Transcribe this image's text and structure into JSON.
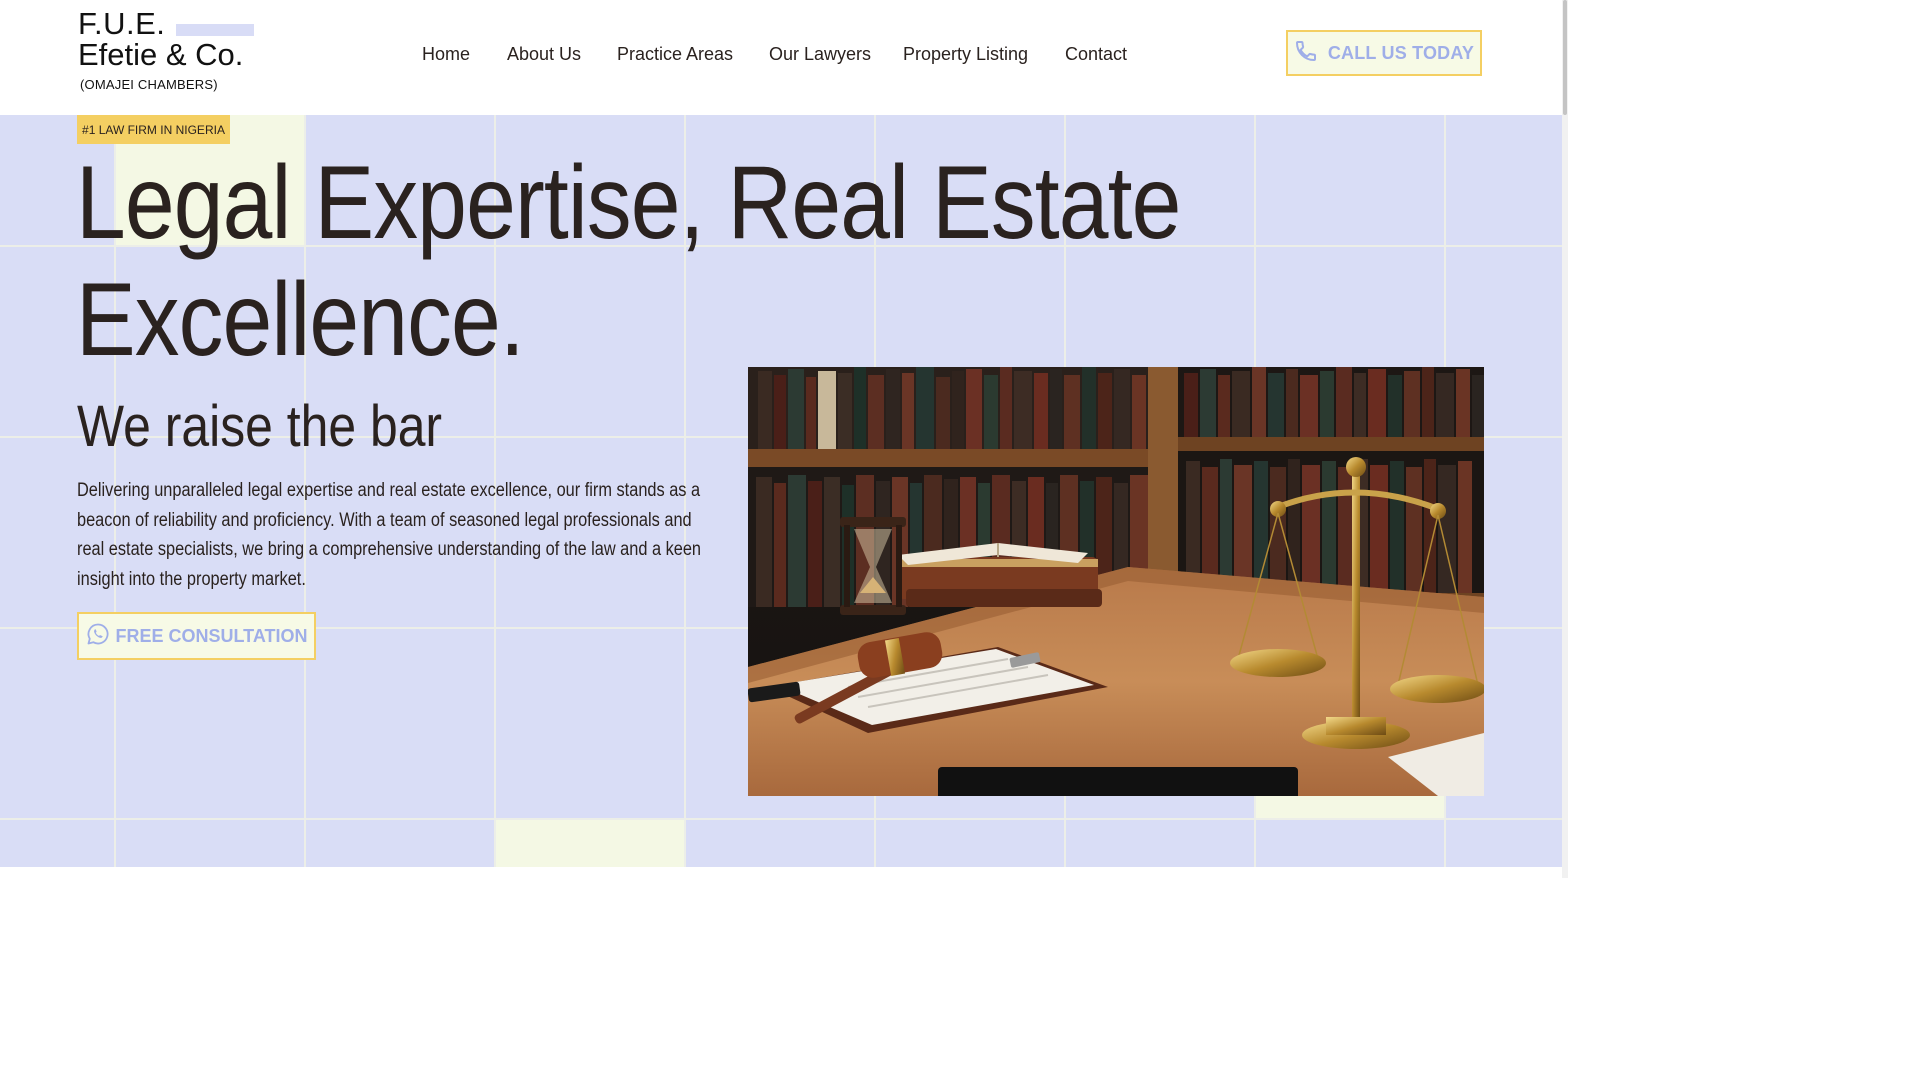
{
  "brand": {
    "line1": "F.U.E.",
    "line2": "Efetie & Co.",
    "subtitle": "(OMAJEI CHAMBERS)"
  },
  "nav": {
    "items": [
      {
        "label": "Home"
      },
      {
        "label": "About Us"
      },
      {
        "label": "Practice Areas"
      },
      {
        "label": "Our Lawyers"
      },
      {
        "label": "Property Listing"
      },
      {
        "label": "Contact"
      }
    ]
  },
  "header_cta": {
    "label": "CALL US TODAY",
    "icon": "phone-icon"
  },
  "hero": {
    "badge": "#1 LAW FIRM IN NIGERIA",
    "headline": "Legal Expertise, Real Estate Excellence.",
    "subheading": "We raise the bar",
    "body": "Delivering unparalleled legal expertise and real estate excellence, our firm stands as a beacon of reliability and proficiency. With a team of seasoned legal professionals and real estate specialists, we bring a comprehensive understanding of the law and a keen insight into the property market.",
    "cta": {
      "label": "FREE CONSULTATION",
      "icon": "whatsapp-icon"
    },
    "image": {
      "subject": "law-office-desk-with-gavel-scales-and-books"
    }
  },
  "colors": {
    "hero_bg": "#d9ddf6",
    "accent_yellow": "#f4cf62",
    "cta_text": "#9faee8",
    "cta_bg": "#f7fae6",
    "text_dark": "#2a221f",
    "tile_highlight": "#f4f8e4"
  }
}
